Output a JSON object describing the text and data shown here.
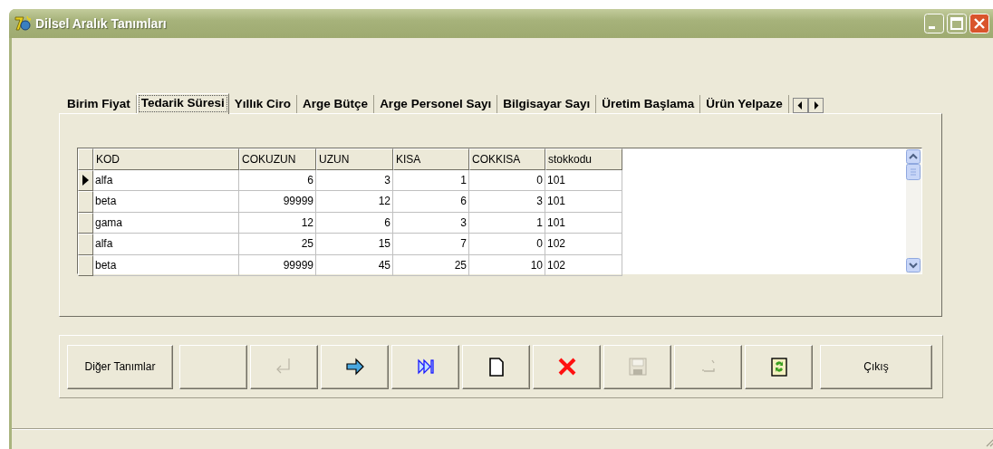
{
  "window": {
    "title": "Dilsel Aralık Tanımları"
  },
  "tabs": [
    {
      "label": "Birim Fiyat",
      "selected": false
    },
    {
      "label": "Tedarik Süresi",
      "selected": true
    },
    {
      "label": "Yıllık Ciro",
      "selected": false
    },
    {
      "label": "Arge Bütçe",
      "selected": false
    },
    {
      "label": "Arge Personel Sayı",
      "selected": false
    },
    {
      "label": "Bilgisayar Sayı",
      "selected": false
    },
    {
      "label": "Üretim Başlama",
      "selected": false
    },
    {
      "label": "Ürün Yelpaze",
      "selected": false
    }
  ],
  "table": {
    "columns": [
      "KOD",
      "COKUZUN",
      "UZUN",
      "KISA",
      "COKKISA",
      "stokkodu"
    ],
    "rows": [
      {
        "cells": [
          "alfa",
          "6",
          "3",
          "1",
          "0",
          "101"
        ],
        "current": true
      },
      {
        "cells": [
          "beta",
          "99999",
          "12",
          "6",
          "3",
          "101"
        ],
        "current": false
      },
      {
        "cells": [
          "gama",
          "12",
          "6",
          "3",
          "1",
          "101"
        ],
        "current": false
      },
      {
        "cells": [
          "alfa",
          "25",
          "15",
          "7",
          "0",
          "102"
        ],
        "current": false
      },
      {
        "cells": [
          "beta",
          "99999",
          "45",
          "25",
          "10",
          "102"
        ],
        "current": false
      }
    ]
  },
  "buttons": [
    {
      "kind": "text",
      "label": "Diğer Tanımlar"
    },
    {
      "kind": "empty"
    },
    {
      "kind": "enter",
      "disabled": true
    },
    {
      "kind": "next",
      "disabled": false
    },
    {
      "kind": "last",
      "disabled": false
    },
    {
      "kind": "new",
      "disabled": false
    },
    {
      "kind": "delete",
      "disabled": false
    },
    {
      "kind": "save",
      "disabled": true
    },
    {
      "kind": "undo",
      "disabled": true
    },
    {
      "kind": "refresh",
      "disabled": false
    },
    {
      "kind": "text",
      "label": "Çıkış"
    }
  ]
}
